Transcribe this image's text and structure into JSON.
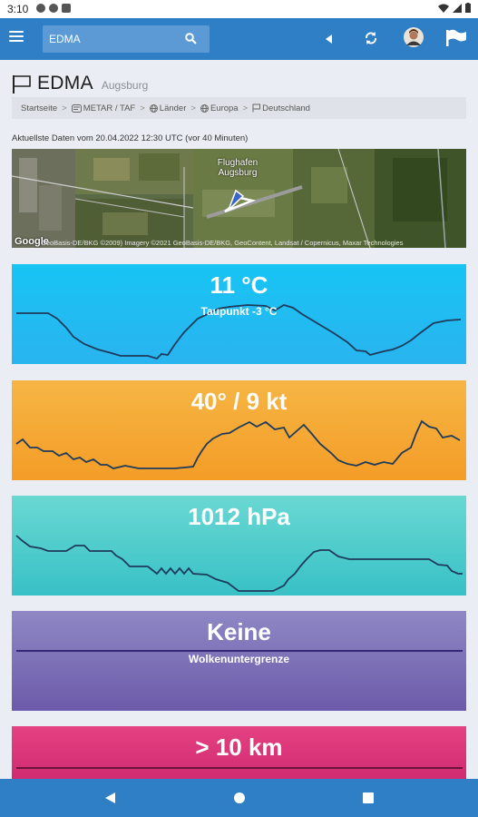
{
  "status": {
    "time": "3:10"
  },
  "appbar": {
    "search_value": "EDMA"
  },
  "station": {
    "code": "EDMA",
    "city": "Augsburg"
  },
  "breadcrumb": [
    "Startseite",
    "METAR / TAF",
    "Länder",
    "Europa",
    "Deutschland"
  ],
  "updated": "Aktuellste Daten vom  20.04.2022 12:30 UTC (vor 40 Minuten)",
  "map": {
    "label_line1": "Flughafen",
    "label_line2": "Augsburg",
    "google": "Google",
    "attribution": "GeoBasis-DE/BKG ©2009) Imagery ©2021 GeoBasis-DE/BKG, GeoContent, Landsat / Copernicus, Maxar Technologies"
  },
  "cards": {
    "temperature": {
      "value": "11 °C",
      "sub": "Taupunkt -3 °C",
      "color": "#1fbff2"
    },
    "wind": {
      "value": "40° / 9 kt",
      "color": "#f5a832"
    },
    "pressure": {
      "value": "1012 hPa",
      "color": "#4fccca"
    },
    "ceiling": {
      "value": "Keine",
      "sub": "Wolkenuntergrenze",
      "color": "#7b71b8"
    },
    "visibility": {
      "value": "> 10 km",
      "color": "#d93577"
    }
  },
  "colors": {
    "appbar": "#2f7fc7",
    "background": "#eaeef4",
    "line": "#1f3b5c"
  },
  "icons": [
    "menu-icon",
    "search-icon",
    "back-triangle-icon",
    "refresh-icon",
    "avatar",
    "flag-brand-icon",
    "flag-icon",
    "home-icon",
    "globe-icon",
    "nav-back-icon",
    "nav-home-icon",
    "nav-recents-icon"
  ]
}
